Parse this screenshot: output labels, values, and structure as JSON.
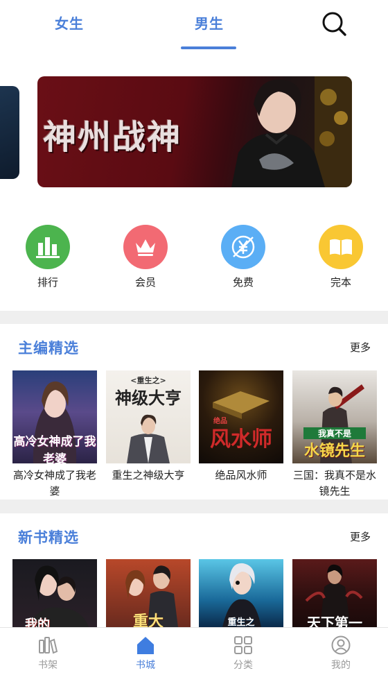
{
  "tabs": {
    "female": "女生",
    "male": "男生"
  },
  "banner": {
    "title": "神州战神"
  },
  "quick_entries": [
    {
      "label": "排行",
      "icon": "ranking-icon",
      "color": "#4cb44e"
    },
    {
      "label": "会员",
      "icon": "crown-icon",
      "color": "#f26a73"
    },
    {
      "label": "免费",
      "icon": "yuan-icon",
      "color": "#5aaef5"
    },
    {
      "label": "完本",
      "icon": "book-icon",
      "color": "#f9c733"
    }
  ],
  "editor_picks": {
    "title": "主编精选",
    "more": "更多",
    "books": [
      {
        "title": "高冷女神成了我老婆",
        "cover_text": "高冷女神成了我老婆"
      },
      {
        "title": "重生之神级大亨",
        "cover_text": "神级大亨",
        "cover_sub": "<重生之>"
      },
      {
        "title": "绝品风水师",
        "cover_text": "风水师",
        "cover_sub": "绝品"
      },
      {
        "title": "三国：我真不是水镜先生",
        "cover_text": "水镜先生",
        "cover_sub": "我真不是"
      }
    ]
  },
  "new_books": {
    "title": "新书精选",
    "more": "更多",
    "books": [
      {
        "cover_text": "我的"
      },
      {
        "cover_text": "重大"
      },
      {
        "cover_text": "重生之"
      },
      {
        "cover_text": "天下第一"
      }
    ]
  },
  "bottom_nav": [
    {
      "label": "书架",
      "icon": "bookshelf-icon",
      "active": false
    },
    {
      "label": "书城",
      "icon": "home-icon",
      "active": true
    },
    {
      "label": "分类",
      "icon": "category-icon",
      "active": false
    },
    {
      "label": "我的",
      "icon": "profile-icon",
      "active": false
    }
  ],
  "colors": {
    "accent": "#4a7fd9",
    "divider": "#efefef",
    "inactive": "#9a9a9a"
  }
}
